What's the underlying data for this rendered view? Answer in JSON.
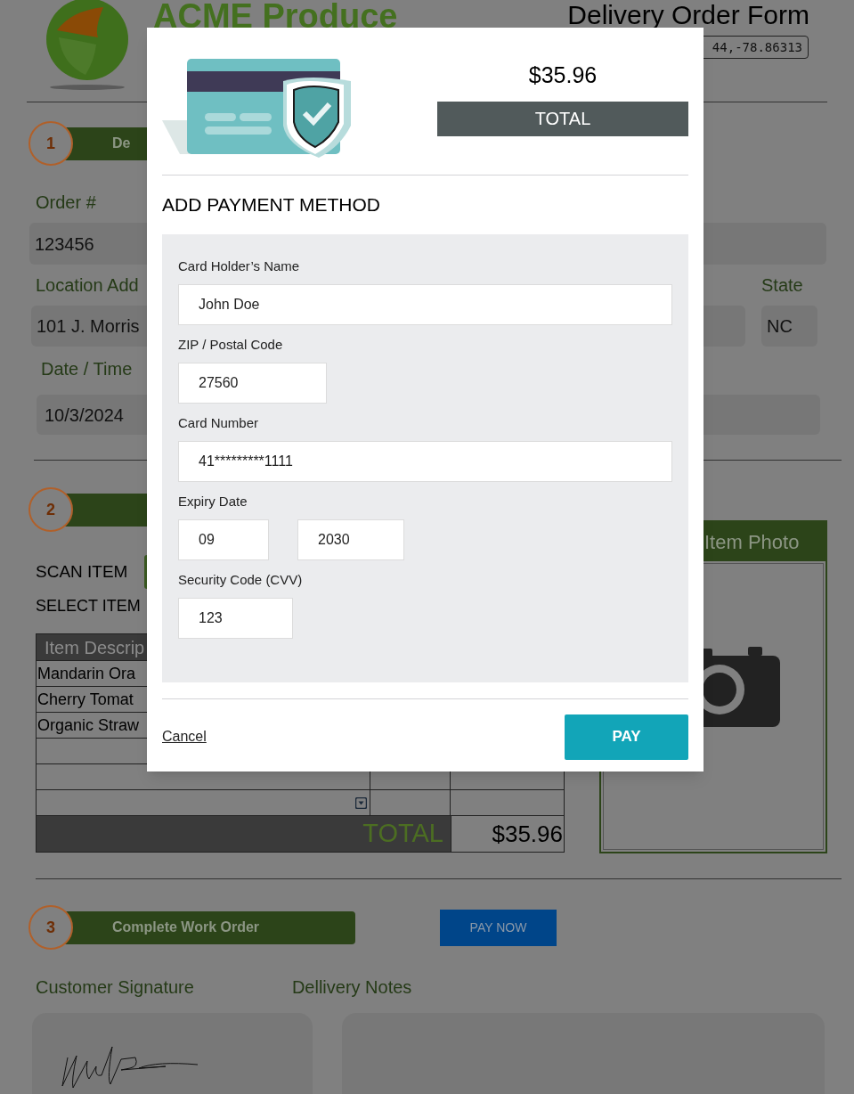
{
  "header": {
    "brand": "ACME Produce",
    "title": "Delivery Order Form",
    "coordinates": "44,-78.86313"
  },
  "step_1": {
    "number": "1",
    "title": "De"
  },
  "order": {
    "label": "Order #",
    "value": "123456"
  },
  "location": {
    "label": "Location Add",
    "value": "101 J. Morris"
  },
  "state": {
    "label": "State",
    "value": "NC"
  },
  "date": {
    "label": "Date / Time",
    "value": "10/3/2024"
  },
  "step_2": {
    "number": "2"
  },
  "scan_label": "SCAN ITEM",
  "select_label": "SELECT ITEM",
  "photo_panel": {
    "title": "Item Photo"
  },
  "items_table": {
    "header": "Item Descrip",
    "rows": [
      "Mandarin Ora",
      "Cherry Tomat",
      "Organic Straw"
    ],
    "total_label": "TOTAL",
    "total": "$35.96"
  },
  "step_3": {
    "number": "3",
    "title": "Complete Work Order"
  },
  "pay_now": "PAY NOW",
  "signature_label": "Customer Signature",
  "notes_label": "Dellivery Notes",
  "payment_modal": {
    "amount": "$35.96",
    "amount_label": "TOTAL",
    "heading": "ADD PAYMENT METHOD",
    "fields": [
      {
        "label": "Card Holder’s Name",
        "values": [
          "John Doe"
        ]
      },
      {
        "label": "ZIP / Postal Code",
        "values": [
          "27560"
        ]
      },
      {
        "label": "Card Number",
        "values": [
          "41*********1111"
        ]
      },
      {
        "label": "Expiry Date",
        "values": [
          "09",
          "2030"
        ]
      },
      {
        "label": "Security Code (CVV)",
        "values": [
          "123"
        ]
      }
    ],
    "cancel": "Cancel",
    "pay": "PAY"
  }
}
